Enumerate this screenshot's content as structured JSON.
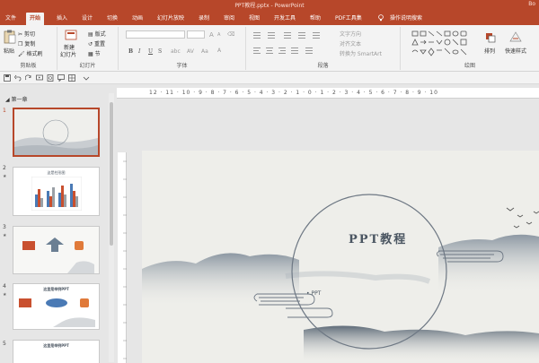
{
  "window": {
    "title": "PPT教程.pptx - PowerPoint",
    "user": "Bo"
  },
  "tabs": [
    {
      "label": "文件"
    },
    {
      "label": "开始"
    },
    {
      "label": "插入"
    },
    {
      "label": "设计"
    },
    {
      "label": "切换"
    },
    {
      "label": "动画"
    },
    {
      "label": "幻灯片放映"
    },
    {
      "label": "录制"
    },
    {
      "label": "审阅"
    },
    {
      "label": "视图"
    },
    {
      "label": "开发工具"
    },
    {
      "label": "帮助"
    },
    {
      "label": "PDF工具集"
    }
  ],
  "active_tab": "开始",
  "tell_me": "操作说明搜索",
  "ribbon": {
    "clipboard": {
      "paste": "粘贴",
      "cut": "剪切",
      "copy": "复制",
      "format_painter": "格式刷",
      "label": "剪贴板"
    },
    "slides": {
      "new_slide": "新建",
      "new_slide2": "幻灯片",
      "layout": "版式",
      "reset": "重置",
      "section": "节",
      "label": "幻灯片"
    },
    "font": {
      "size_up": "A",
      "size_down": "A",
      "bold": "B",
      "italic": "I",
      "underline": "U",
      "strike": "S",
      "label": "字体"
    },
    "paragraph": {
      "text_direction": "文字方向",
      "align_text": "对齐文本",
      "smartart": "转换为 SmartArt",
      "label": "段落"
    },
    "drawing": {
      "arrange": "排列",
      "quick_styles": "快速样式",
      "label": "绘图"
    }
  },
  "slides_pane": {
    "section": "第一章",
    "thumbs": [
      {
        "num": "1",
        "title": "PPT教程"
      },
      {
        "num": "2",
        "title": "这是柱形图"
      },
      {
        "num": "3",
        "title": ""
      },
      {
        "num": "4",
        "title": "这里是举例PPT"
      },
      {
        "num": "5",
        "title": "这里是举例PPT"
      }
    ]
  },
  "ruler": {
    "numbers": "12 · 11 · 10 · 9 · 8 · 7 · 6 · 5 · 4 · 3 · 2 · 1 · 0 · 1 · 2 · 3 · 4 · 5 · 6 · 7 · 8 · 9 · 10"
  },
  "slide": {
    "title": "PPT教程",
    "subtitle": "• PPT"
  },
  "colors": {
    "accent": "#b7472a",
    "ribbon_bg": "#f3f3f3",
    "slide_ink": "#4a5561"
  }
}
